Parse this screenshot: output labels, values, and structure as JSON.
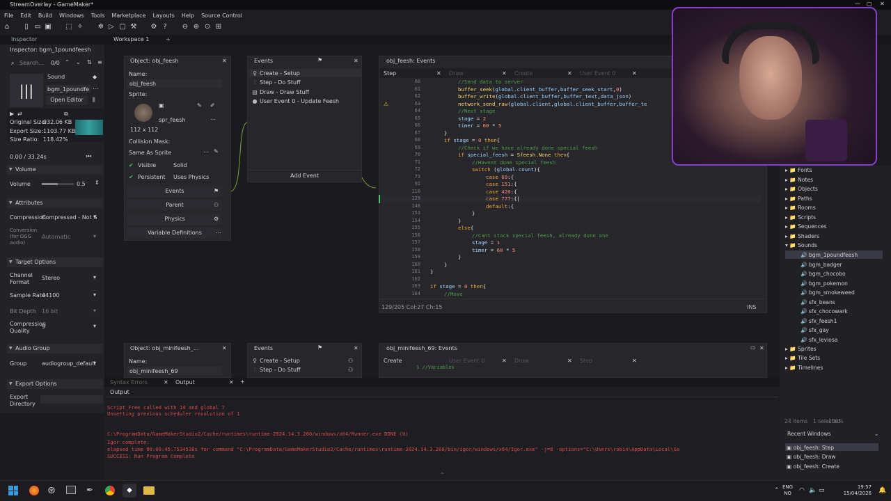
{
  "window": {
    "title": "StreamOverlay - GameMaker*",
    "controls": [
      "—",
      "▢",
      "✕"
    ]
  },
  "menu": [
    "File",
    "Edit",
    "Build",
    "Windows",
    "Tools",
    "Marketplace",
    "Layouts",
    "Help",
    "Source Control"
  ],
  "tabs": {
    "inspector": "Inspector",
    "workspace": "Workspace 1",
    "add": "+"
  },
  "inspector": {
    "title": "Inspector: bgm_1poundfeesh",
    "search_placeholder": "Search...",
    "search_count": "0/0",
    "sound_label": "Sound",
    "sound_name": "bgm_1poundfe",
    "open_editor": "Open Editor",
    "original_size_label": "Original Size:",
    "original_size": "932.06 KB",
    "export_size_label": "Export Size:",
    "export_size": "1103.77 KB",
    "size_ratio_label": "Size Ratio:",
    "size_ratio": "118.42%",
    "time": "0.00 / 33.24s",
    "volume_section": "Volume",
    "volume_label": "Volume",
    "volume_value": "0.5",
    "volume_level": 0.5,
    "attributes_section": "Attributes",
    "compression_label": "Compression",
    "compression_value": "Compressed - Not S",
    "conversion_label": "Conversion (for OGG audio)",
    "conversion_value": "Automatic",
    "target_section": "Target Options",
    "channel_label": "Channel Format",
    "channel_value": "Stereo",
    "sample_label": "Sample Rate",
    "sample_value": "44100",
    "bitdepth_label": "Bit Depth",
    "bitdepth_value": "16 bit",
    "quality_label": "Compression Quality",
    "quality_value": "9",
    "audiogroup_section": "Audio Group",
    "group_label": "Group",
    "group_value": "audiogroup_default",
    "export_section": "Export Options",
    "export_dir_label": "Export Directory"
  },
  "object": {
    "title": "Object: obj_feesh",
    "name_label": "Name:",
    "name_value": "obj_feesh",
    "sprite_label": "Sprite:",
    "sprite_name": "spr_feesh",
    "sprite_size": "112 x 112",
    "collision_label": "Collision Mask:",
    "collision_value": "Same As Sprite",
    "visible": "Visible",
    "solid": "Solid",
    "persistent": "Persistent",
    "uses_physics": "Uses Physics",
    "events_btn": "Events",
    "parent_btn": "Parent",
    "physics_btn": "Physics",
    "variable_btn": "Variable Definitions"
  },
  "events": {
    "title": "Events",
    "items": [
      "Create - Setup",
      "Step - Do Stuff",
      "Draw - Draw Stuff",
      "User Event 0 - Update Feesh"
    ],
    "add_event": "Add Event"
  },
  "code": {
    "title": "obj_feesh: Events",
    "tabs": [
      "Step",
      "Draw",
      "Create",
      "User Event 0"
    ],
    "status": "129/205 Col:27 Ch:15",
    "mode": "INS"
  },
  "object2": {
    "title": "Object: obj_minifeesh_...",
    "name_label": "Name:",
    "name_value": "obj_minifeesh_69"
  },
  "events2": {
    "title": "Events",
    "items": [
      "Create - Setup",
      "Step - Do Stuff"
    ]
  },
  "code2": {
    "title": "obj_minifeesh_69: Events",
    "tabs": [
      "Create",
      "User Event 0",
      "Draw",
      "Step"
    ],
    "line1": "1   //Variables"
  },
  "output": {
    "tabs": [
      "Syntax Errors",
      "Output"
    ],
    "heading": "Output",
    "lines": [
      "Script_Free called with 14 and global 7",
      "Unsetting previous scheduler resolution of 1",
      "",
      "C:\\ProgramData/GameMakerStudio2/Cache/runtimes\\runtime-2024.14.3.260/windows/x64/Runner.exe DONE (0)",
      "Igor complete.",
      "elapsed time 00:00:45.7534538s for command \"C:\\ProgramData/GameMakerStudio2/Cache/runtimes\\runtime-2024.14.3.260/bin/igor/windows/x64/Igor.exe\" -j=8 -options=\"C:\\Users\\robin\\AppData\\Local\\Ga",
      "SUCCESS: Run Program Complete"
    ]
  },
  "resources": {
    "groups": [
      "Fonts",
      "Notes",
      "Objects",
      "Paths",
      "Rooms",
      "Scripts",
      "Sequences",
      "Shaders",
      "Sounds"
    ],
    "sounds": [
      "bgm_1poundfeesh",
      "bgm_badger",
      "bgm_chocobo",
      "bgm_pokemon",
      "bgm_smokeweed",
      "sfx_beans",
      "sfx_chocowark",
      "sfx_feesh1",
      "sfx_gay",
      "sfx_leviosa"
    ],
    "after": [
      "Sprites",
      "Tile Sets",
      "Timelines"
    ],
    "count": "24 items",
    "selected": "1 selected",
    "zoom": "100%",
    "recent_title": "Recent Windows",
    "recent": [
      "obj_feesh: Step",
      "obj_feesh: Draw",
      "obj_feesh: Create"
    ]
  },
  "taskbar": {
    "lang": "ENG",
    "region": "NO",
    "time": "19:57",
    "date": "15/04/2026"
  }
}
